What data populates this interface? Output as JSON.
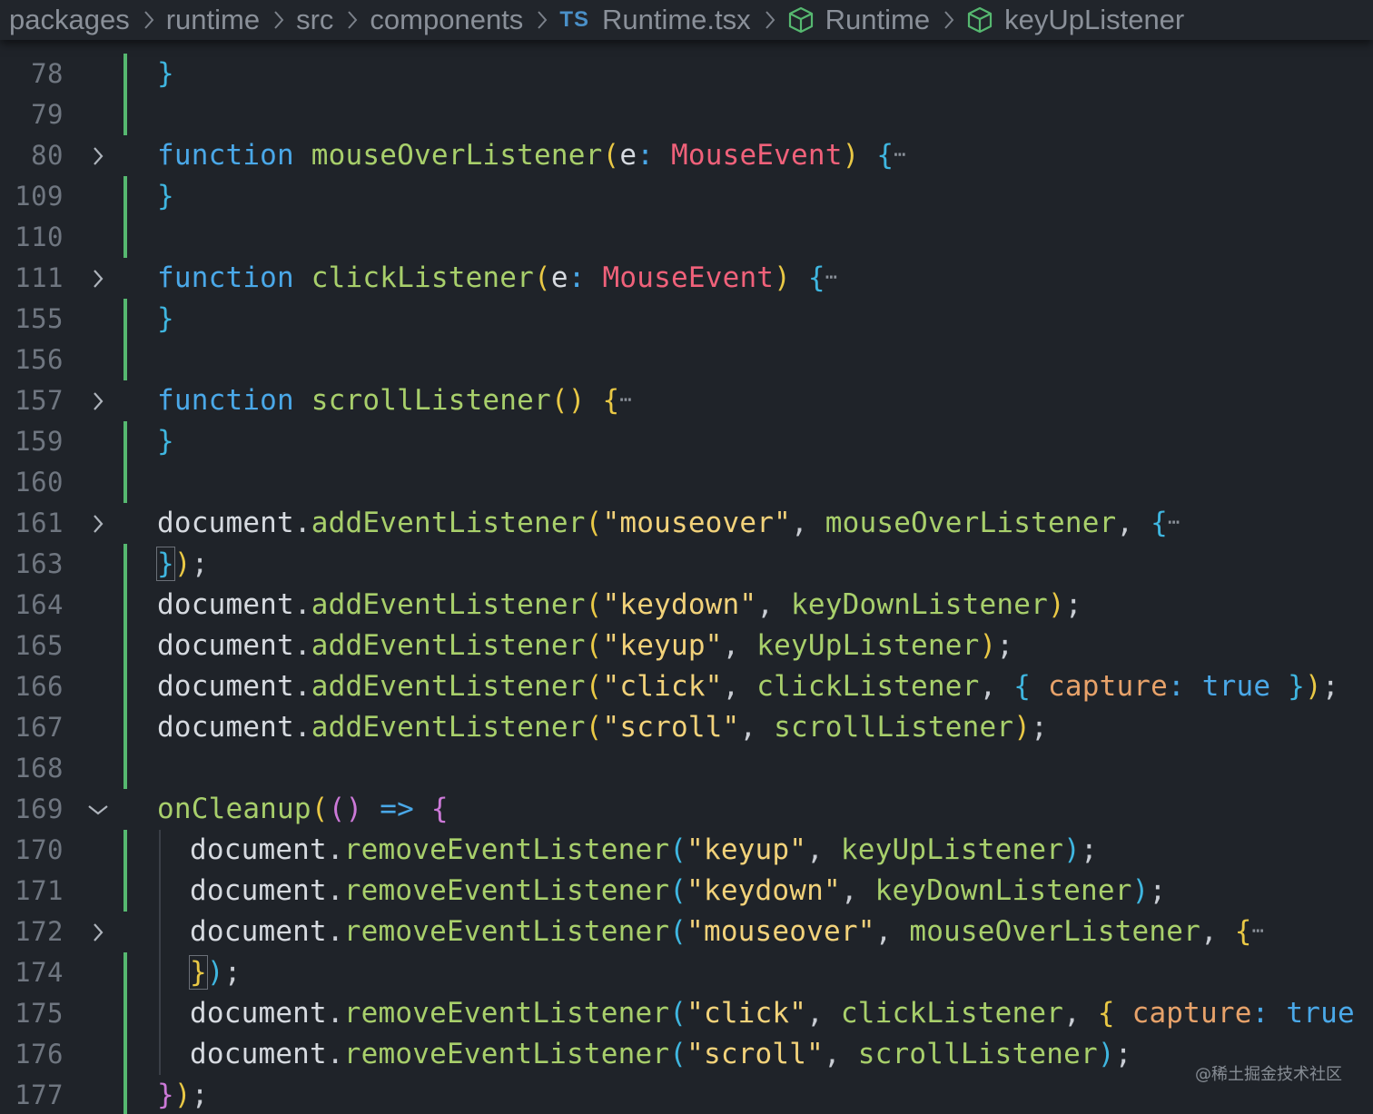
{
  "breadcrumb": {
    "items": [
      "packages",
      "runtime",
      "src",
      "components",
      "Runtime.tsx",
      "Runtime",
      "keyUpListener"
    ],
    "ts_badge": "TS"
  },
  "lines": [
    {
      "n": "78"
    },
    {
      "n": "79"
    },
    {
      "n": "80"
    },
    {
      "n": "109"
    },
    {
      "n": "110"
    },
    {
      "n": "111"
    },
    {
      "n": "155"
    },
    {
      "n": "156"
    },
    {
      "n": "157"
    },
    {
      "n": "159"
    },
    {
      "n": "160"
    },
    {
      "n": "161"
    },
    {
      "n": "163"
    },
    {
      "n": "164"
    },
    {
      "n": "165"
    },
    {
      "n": "166"
    },
    {
      "n": "167"
    },
    {
      "n": "168"
    },
    {
      "n": "169"
    },
    {
      "n": "170"
    },
    {
      "n": "171"
    },
    {
      "n": "172"
    },
    {
      "n": "174"
    },
    {
      "n": "175"
    },
    {
      "n": "176"
    },
    {
      "n": "177"
    }
  ],
  "code": {
    "l78": "}",
    "l80": [
      "function",
      "mouseOverListener",
      "(",
      "e",
      ":",
      "MouseEvent",
      ")",
      "{"
    ],
    "l109": "}",
    "l111": [
      "function",
      "clickListener",
      "(",
      "e",
      ":",
      "MouseEvent",
      ")",
      "{"
    ],
    "l155": "}",
    "l157": [
      "function",
      "scrollListener",
      "()",
      "{"
    ],
    "l159": "}",
    "l161": [
      "document",
      ".",
      "addEventListener",
      "(",
      "\"mouseover\"",
      ", ",
      "mouseOverListener",
      ", ",
      "{"
    ],
    "l163": [
      "}",
      ")",
      ";"
    ],
    "l164": [
      "document",
      ".",
      "addEventListener",
      "(",
      "\"keydown\"",
      ", ",
      "keyDownListener",
      ")",
      ";"
    ],
    "l165": [
      "document",
      ".",
      "addEventListener",
      "(",
      "\"keyup\"",
      ", ",
      "keyUpListener",
      ")",
      ";"
    ],
    "l166": [
      "document",
      ".",
      "addEventListener",
      "(",
      "\"click\"",
      ", ",
      "clickListener",
      ", ",
      "{",
      " capture",
      ":",
      " true",
      " }",
      ")",
      ";"
    ],
    "l167": [
      "document",
      ".",
      "addEventListener",
      "(",
      "\"scroll\"",
      ", ",
      "scrollListener",
      ")",
      ";"
    ],
    "l169": [
      "onCleanup",
      "(",
      "()",
      " => ",
      "{"
    ],
    "l170": [
      "document",
      ".",
      "removeEventListener",
      "(",
      "\"keyup\"",
      ", ",
      "keyUpListener",
      ")",
      ";"
    ],
    "l171": [
      "document",
      ".",
      "removeEventListener",
      "(",
      "\"keydown\"",
      ", ",
      "keyDownListener",
      ")",
      ";"
    ],
    "l172": [
      "document",
      ".",
      "removeEventListener",
      "(",
      "\"mouseover\"",
      ", ",
      "mouseOverListener",
      ", ",
      "{"
    ],
    "l174": [
      "}",
      ")",
      ";"
    ],
    "l175": [
      "document",
      ".",
      "removeEventListener",
      "(",
      "\"click\"",
      ", ",
      "clickListener",
      ", ",
      "{",
      " capture",
      ":",
      " true",
      " }",
      ")",
      ";"
    ],
    "l176": [
      "document",
      ".",
      "removeEventListener",
      "(",
      "\"scroll\"",
      ", ",
      "scrollListener",
      ")",
      ";"
    ],
    "l177": [
      "}",
      ")",
      ";"
    ]
  },
  "ellipsis": "⋯",
  "watermark": "@稀土掘金技术社区",
  "colors": {
    "background": "#1f2329",
    "keyword": "#4aa8e8",
    "function": "#a8cf6b",
    "type": "#f0617a",
    "string": "#f2d27a",
    "git_added": "#56b870"
  }
}
